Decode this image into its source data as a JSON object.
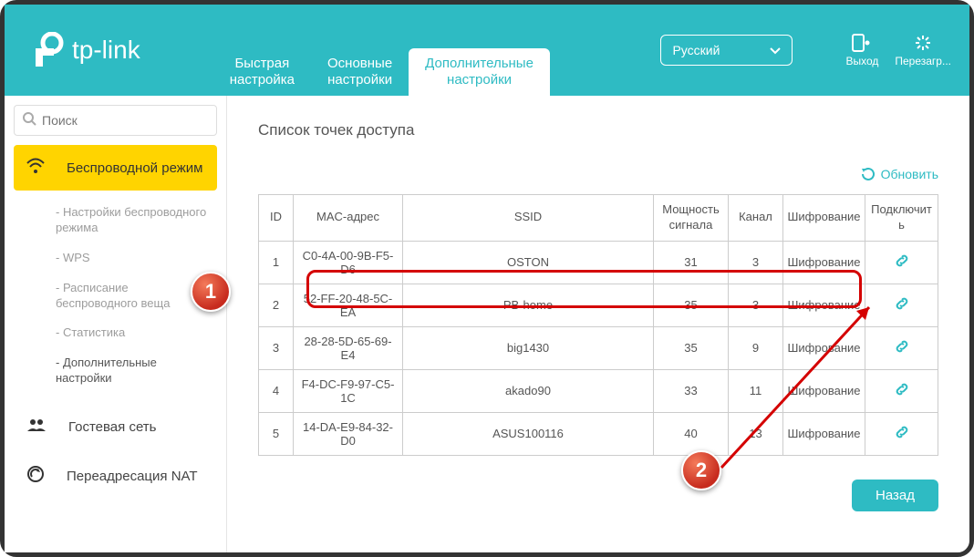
{
  "header": {
    "logo_text": "tp-link",
    "tabs": [
      {
        "line1": "Быстрая",
        "line2": "настройка"
      },
      {
        "line1": "Основные",
        "line2": "настройки"
      },
      {
        "line1": "Дополнительные",
        "line2": "настройки"
      }
    ],
    "language": "Русский",
    "logout_label": "Выход",
    "reboot_label": "Перезагр..."
  },
  "sidebar": {
    "search_placeholder": "Поиск",
    "wireless_label": "Беспроводной режим",
    "subs": [
      "- Настройки беспроводного режима",
      "- WPS",
      "- Расписание беспроводного веща",
      "- Статистика",
      "- Дополнительные настройки"
    ],
    "guest_label": "Гостевая сеть",
    "nat_label": "Переадресация NAT"
  },
  "content": {
    "title": "Список точек доступа",
    "refresh_label": "Обновить",
    "columns": [
      "ID",
      "MAC-адрес",
      "SSID",
      "Мощность сигнала",
      "Канал",
      "Шифрование",
      "Подключить"
    ],
    "rows": [
      {
        "id": "1",
        "mac": "C0-4A-00-9B-F5-D6",
        "ssid": "OSTON",
        "signal": "31",
        "channel": "3",
        "enc": "Шифрование"
      },
      {
        "id": "2",
        "mac": "52-FF-20-48-5C-EA",
        "ssid": "PB-home",
        "signal": "35",
        "channel": "3",
        "enc": "Шифрование"
      },
      {
        "id": "3",
        "mac": "28-28-5D-65-69-E4",
        "ssid": "big1430",
        "signal": "35",
        "channel": "9",
        "enc": "Шифрование"
      },
      {
        "id": "4",
        "mac": "F4-DC-F9-97-C5-1C",
        "ssid": "akado90",
        "signal": "33",
        "channel": "11",
        "enc": "Шифрование"
      },
      {
        "id": "5",
        "mac": "14-DA-E9-84-32-D0",
        "ssid": "ASUS100116",
        "signal": "40",
        "channel": "13",
        "enc": "Шифрование"
      }
    ],
    "back_label": "Назад"
  },
  "annotations": {
    "b1": "1",
    "b2": "2"
  }
}
